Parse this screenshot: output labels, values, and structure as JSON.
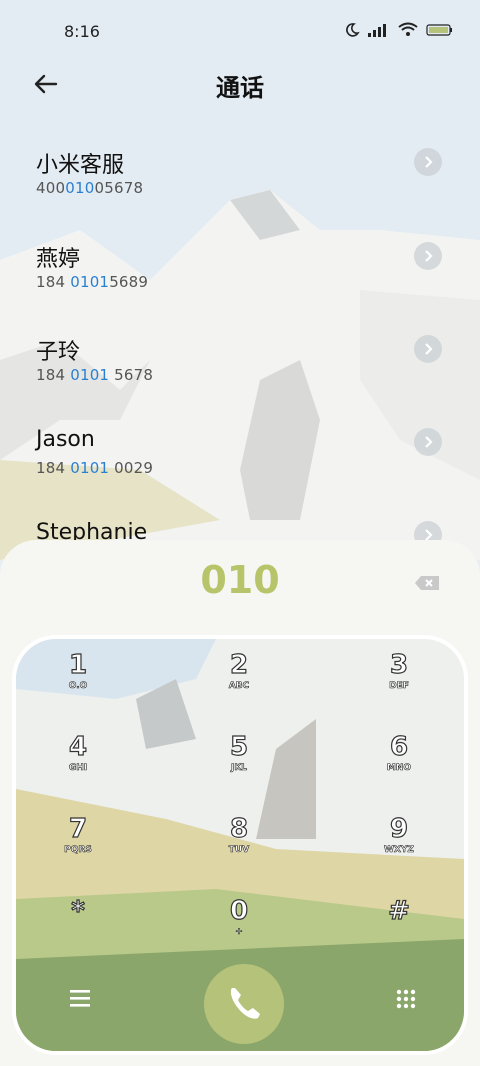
{
  "status": {
    "time": "8:16"
  },
  "header": {
    "title": "通话"
  },
  "contacts": [
    {
      "name": "小米客服",
      "pre": "400",
      "hl": "010",
      "post": "05678"
    },
    {
      "name": "燕婷",
      "pre": "184 ",
      "hl": "0101",
      "post": "5689"
    },
    {
      "name": "子玲",
      "pre": "184 ",
      "hl": "0101",
      "post": " 5678"
    },
    {
      "name": "Jason",
      "pre": "184 ",
      "hl": "0101",
      "post": " 0029"
    },
    {
      "name": "Stephanie",
      "pre": "",
      "hl": "",
      "post": ""
    }
  ],
  "dialer": {
    "input": "010",
    "keys": [
      {
        "digit": "1",
        "letters": "O.O"
      },
      {
        "digit": "2",
        "letters": "ABC"
      },
      {
        "digit": "3",
        "letters": "DEF"
      },
      {
        "digit": "4",
        "letters": "GHI"
      },
      {
        "digit": "5",
        "letters": "JKL"
      },
      {
        "digit": "6",
        "letters": "MNO"
      },
      {
        "digit": "7",
        "letters": "PQRS"
      },
      {
        "digit": "8",
        "letters": "TUV"
      },
      {
        "digit": "9",
        "letters": "WXYZ"
      },
      {
        "digit": "*",
        "letters": ""
      },
      {
        "digit": "0",
        "letters": "+"
      },
      {
        "digit": "#",
        "letters": ""
      }
    ]
  },
  "colors": {
    "accent": "#b5c27a",
    "highlight": "#2b7fd1"
  }
}
